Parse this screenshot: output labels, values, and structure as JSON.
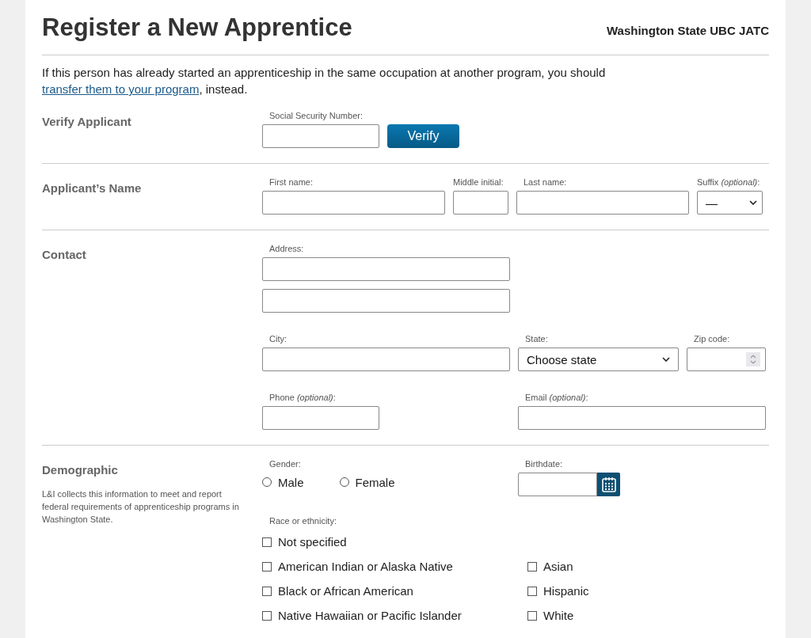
{
  "header": {
    "title": "Register a New Apprentice",
    "organization": "Washington State UBC JATC"
  },
  "intro": {
    "before": "If this person has already started an apprenticeship in the same occupation at another program, you should ",
    "link": "transfer them to your program",
    "after": ", instead."
  },
  "verify": {
    "heading": "Verify Applicant",
    "ssn_label": "Social Security Number:",
    "button": "Verify"
  },
  "name": {
    "heading": "Applicant’s Name",
    "first_label": "First name:",
    "middle_label": "Middle initial:",
    "last_label": "Last name:",
    "suffix_label": "Suffix *(optional)*:",
    "suffix_value": "—"
  },
  "contact": {
    "heading": "Contact",
    "address_label": "Address:",
    "city_label": "City:",
    "state_label": "State:",
    "state_value": "Choose state",
    "zip_label": "Zip code:",
    "phone_label": "Phone *(optional)*:",
    "email_label": "Email *(optional)*:"
  },
  "demographic": {
    "heading": "Demographic",
    "description": "L&I collects this information to meet and report federal requirements of apprenticeship programs in Washington State.",
    "gender_label": "Gender:",
    "genders": [
      {
        "label": "Male",
        "selected": false
      },
      {
        "label": "Female",
        "selected": false
      }
    ],
    "birthdate_label": "Birthdate:",
    "race_label": "Race or ethnicity:",
    "races_single": [
      {
        "label": "Not specified",
        "checked": false
      }
    ],
    "races_left": [
      {
        "label": "American Indian or Alaska Native",
        "checked": false
      },
      {
        "label": "Black or African American",
        "checked": false
      },
      {
        "label": "Native Hawaiian or Pacific Islander",
        "checked": false
      }
    ],
    "races_right": [
      {
        "label": "Asian",
        "checked": false
      },
      {
        "label": "Hispanic",
        "checked": false
      },
      {
        "label": "White",
        "checked": false
      }
    ]
  }
}
